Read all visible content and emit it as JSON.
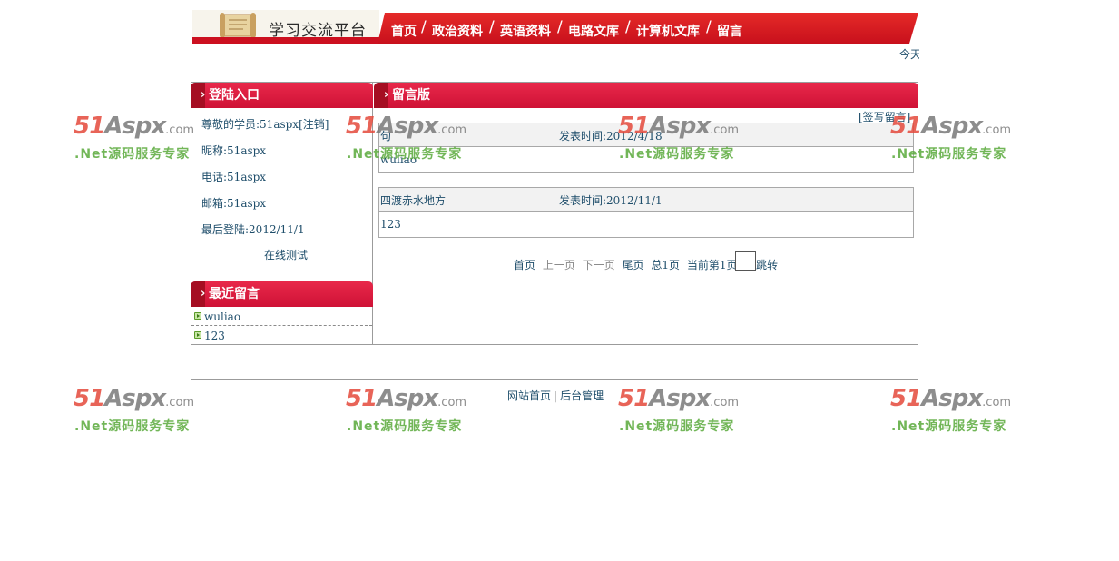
{
  "header": {
    "site_title": "学习交流平台",
    "nav": [
      "首页",
      "政治资料",
      "英语资料",
      "电路文库",
      "计算机文库",
      "留言"
    ],
    "today_text": "今天"
  },
  "login_panel": {
    "title": "登陆入口",
    "welcome": "尊敬的学员:51aspx",
    "logout": "[注销]",
    "nickname": "昵称:51aspx",
    "phone": "电话:51aspx",
    "email": "邮箱:51aspx",
    "last_login": "最后登陆:2012/11/1",
    "online_test": "在线测试"
  },
  "recent_panel": {
    "title": "最近留言",
    "items": [
      "wuliao",
      "123"
    ]
  },
  "guestbook": {
    "title": "留言版",
    "write_link": "[签写留言]",
    "messages": [
      {
        "author": "句",
        "time": "发表时间:2012/4/18",
        "content": "wuliao"
      },
      {
        "author": "四渡赤水地方",
        "time": "发表时间:2012/11/1",
        "content": "123"
      }
    ],
    "pager": {
      "first": "首页",
      "prev": "上一页",
      "next": "下一页",
      "last": "尾页",
      "total": "总1页",
      "current": "当前第1页",
      "jump": "跳转"
    }
  },
  "footer": {
    "home": "网站首页",
    "separator": "|",
    "admin": "后台管理"
  },
  "watermark": {
    "brand_num": "51",
    "brand_name": "Aspx",
    "brand_domain": ".com",
    "slogan": ".Net源码服务专家"
  },
  "colors": {
    "nav_red": "#d01a24",
    "panel_red": "#dc1c40",
    "link_blue": "#1f4e6b",
    "watermark_red": "#e44a3c",
    "watermark_green": "#5aaa3c"
  }
}
